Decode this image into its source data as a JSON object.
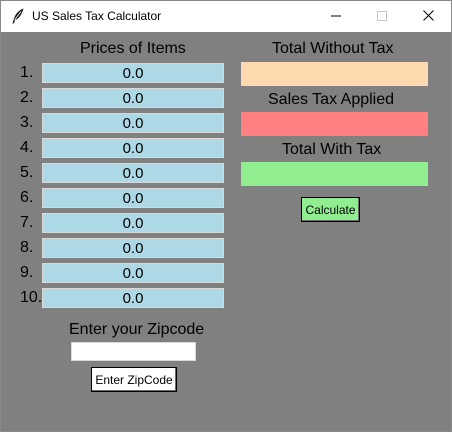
{
  "window": {
    "title": "US Sales Tax Calculator"
  },
  "prices": {
    "title": "Prices of Items",
    "items": [
      {
        "num": "1.",
        "value": "0.0"
      },
      {
        "num": "2.",
        "value": "0.0"
      },
      {
        "num": "3.",
        "value": "0.0"
      },
      {
        "num": "4.",
        "value": "0.0"
      },
      {
        "num": "5.",
        "value": "0.0"
      },
      {
        "num": "6.",
        "value": "0.0"
      },
      {
        "num": "7.",
        "value": "0.0"
      },
      {
        "num": "8.",
        "value": "0.0"
      },
      {
        "num": "9.",
        "value": "0.0"
      },
      {
        "num": "10.",
        "value": "0.0"
      }
    ]
  },
  "results": {
    "without_tax_label": "Total Without Tax",
    "without_tax_value": "",
    "without_tax_color": "#ffdab0",
    "tax_label": "Sales Tax Applied",
    "tax_value": "",
    "tax_color": "#ff8080",
    "with_tax_label": "Total With Tax",
    "with_tax_value": "",
    "with_tax_color": "#90ee90"
  },
  "calculate_label": "Calculate",
  "zip": {
    "label": "Enter your Zipcode",
    "value": "",
    "button_label": "Enter ZipCode"
  },
  "icons": {
    "app": "feather-icon",
    "minimize": "minimize-icon",
    "maximize": "maximize-icon",
    "close": "close-icon"
  }
}
